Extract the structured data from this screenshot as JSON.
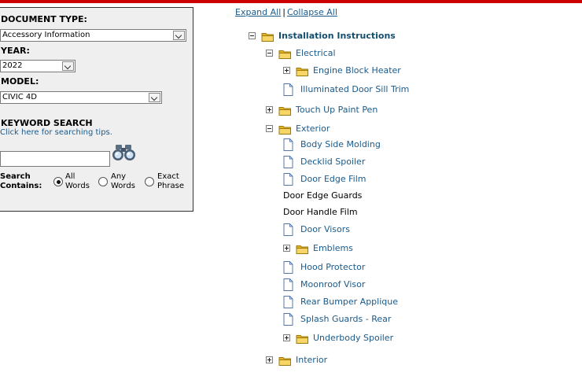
{
  "search_panel": {
    "doc_type_label": "DOCUMENT TYPE:",
    "doc_type_value": "Accessory Information",
    "year_label": "YEAR:",
    "year_value": "2022",
    "model_label": "MODEL:",
    "model_value": "CIVIC 4D",
    "keyword_label": "KEYWORD SEARCH",
    "tips_link": "Click here for searching tips.",
    "keyword_value": "",
    "search_contains_line1": "Search",
    "search_contains_line2": "Contains:",
    "options": [
      {
        "line1": "All",
        "line2": "Words",
        "selected": true
      },
      {
        "line1": "Any",
        "line2": "Words",
        "selected": false
      },
      {
        "line1": "Exact",
        "line2": "Phrase",
        "selected": false
      }
    ]
  },
  "tree_links": {
    "expand_all": "Expand All",
    "separator": "|",
    "collapse_all": "Collapse All"
  },
  "tree": [
    {
      "label": "Installation Instructions",
      "icon": "folder-icon",
      "toggle": "minus",
      "level": 0,
      "style": "bold"
    },
    {
      "label": "Electrical",
      "icon": "folder-icon",
      "toggle": "minus",
      "level": 1
    },
    {
      "label": "Engine Block Heater",
      "icon": "folder-icon",
      "toggle": "plus",
      "level": 2
    },
    {
      "label": "Illuminated Door Sill Trim",
      "icon": "document-icon",
      "toggle": "none",
      "level": 2
    },
    {
      "label": "Touch Up Paint Pen",
      "icon": "folder-icon",
      "toggle": "plus",
      "level": 1
    },
    {
      "label": "Exterior",
      "icon": "folder-icon",
      "toggle": "minus",
      "level": 1
    },
    {
      "label": "Body Side Molding",
      "icon": "document-icon",
      "toggle": "none",
      "level": 2
    },
    {
      "label": "Decklid Spoiler",
      "icon": "document-icon",
      "toggle": "none",
      "level": 2
    },
    {
      "label": "Door Edge Film",
      "icon": "document-icon",
      "toggle": "none",
      "level": 2
    },
    {
      "label": "Door Edge Guards",
      "icon": "none",
      "toggle": "none",
      "level": 2,
      "style": "plain"
    },
    {
      "label": "Door Handle Film",
      "icon": "none",
      "toggle": "none",
      "level": 2,
      "style": "plain"
    },
    {
      "label": "Door Visors",
      "icon": "document-icon",
      "toggle": "none",
      "level": 2
    },
    {
      "label": "Emblems",
      "icon": "folder-icon",
      "toggle": "plus",
      "level": 2
    },
    {
      "label": "Hood Protector",
      "icon": "document-icon",
      "toggle": "none",
      "level": 2
    },
    {
      "label": "Moonroof Visor",
      "icon": "document-icon",
      "toggle": "none",
      "level": 2
    },
    {
      "label": "Rear Bumper Applique",
      "icon": "document-icon",
      "toggle": "none",
      "level": 2
    },
    {
      "label": "Splash Guards - Rear",
      "icon": "document-icon",
      "toggle": "none",
      "level": 2
    },
    {
      "label": "Underbody Spoiler",
      "icon": "folder-icon",
      "toggle": "plus",
      "level": 2
    },
    {
      "label": "Interior",
      "icon": "folder-icon",
      "toggle": "plus",
      "level": 1
    }
  ],
  "colors": {
    "top_bar": "#cc0000",
    "link": "#1a5a8a",
    "panel_bg": "#efefef",
    "folder": "#f2c94c"
  }
}
